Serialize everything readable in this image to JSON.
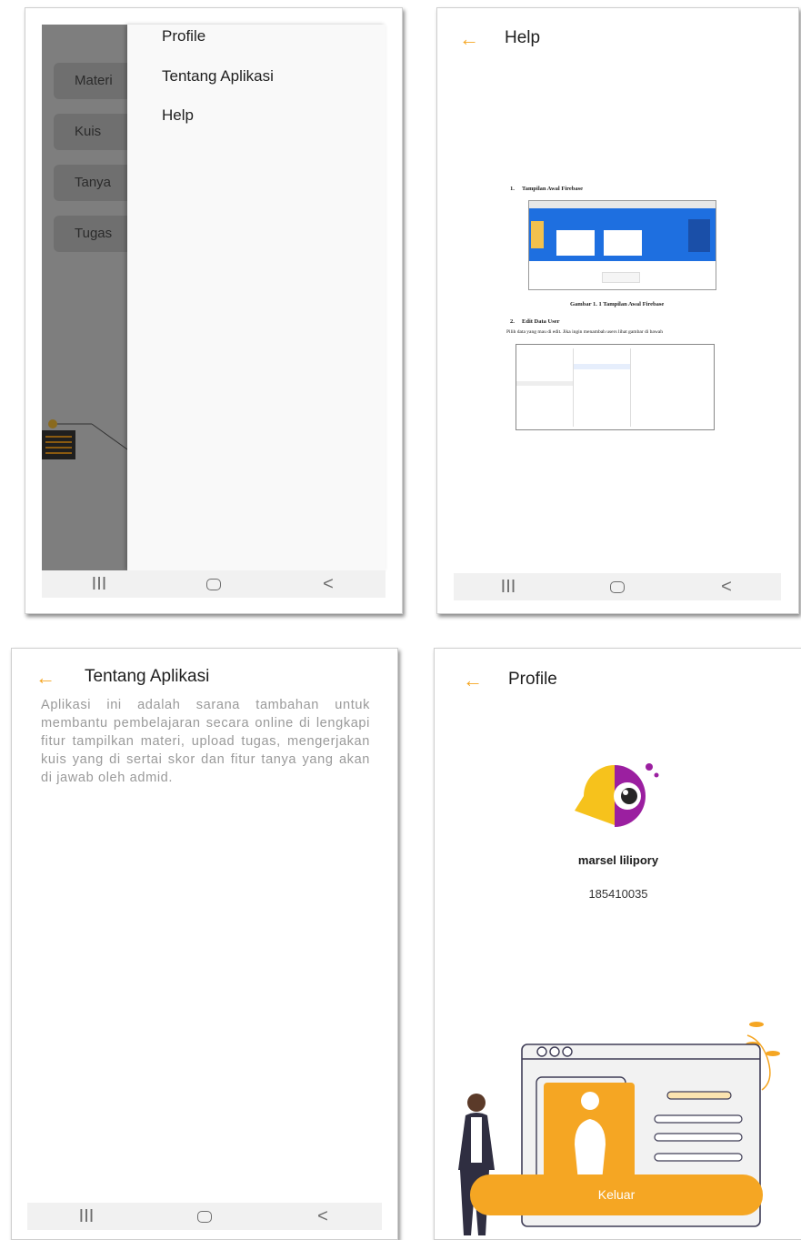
{
  "colors": {
    "accent": "#f5a623",
    "purple": "#9b1fa0",
    "overlay": "#7e7e7e"
  },
  "screen1": {
    "menu_buttons": [
      "Materi",
      "Kuis",
      "Tanya",
      "Tugas"
    ],
    "drawer_items": [
      "Profile",
      "Tentang Aplikasi",
      "Help"
    ]
  },
  "navbar": {
    "recents": "III",
    "back": "<"
  },
  "screen2": {
    "title": "Help",
    "doc": {
      "section1": "1.     Tampilan Awal Firebase",
      "caption1": "Gambar 1. 1 Tampilan Awal Firebase",
      "section2": "2.     Edit Data User",
      "body2": "Pilih data yang mau di edit. Jika ingin menambah users lihat gambar di bawah"
    }
  },
  "screen3": {
    "title": "Tentang Aplikasi",
    "description": "Aplikasi ini adalah sarana tambahan untuk membantu pembelajaran secara online di lengkapi fitur tampilkan materi, upload tugas, mengerjakan kuis yang di sertai skor dan fitur tanya yang akan di jawab oleh admid."
  },
  "screen4": {
    "title": "Profile",
    "name": "marsel lilipory",
    "id_number": "185410035",
    "logout_label": "Keluar"
  }
}
